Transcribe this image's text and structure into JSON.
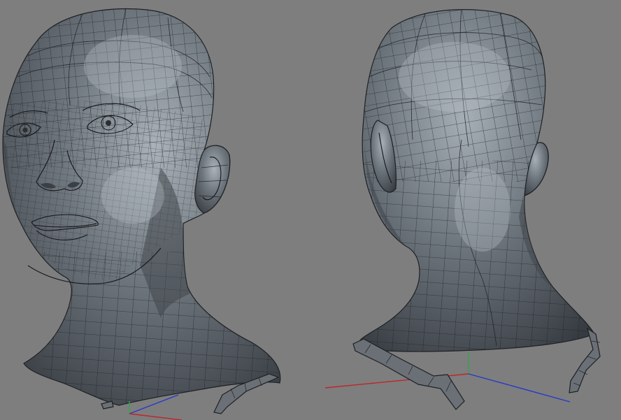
{
  "viewport": {
    "background": "#7e7e7e",
    "mesh_color": "#6b737a",
    "wire_color": "#1b1e22"
  },
  "axes": {
    "x_color": "#c0242a",
    "y_color": "#2fa84a",
    "z_color": "#2838c8"
  },
  "views": [
    {
      "name": "front-three-quarter"
    },
    {
      "name": "back-three-quarter"
    }
  ]
}
